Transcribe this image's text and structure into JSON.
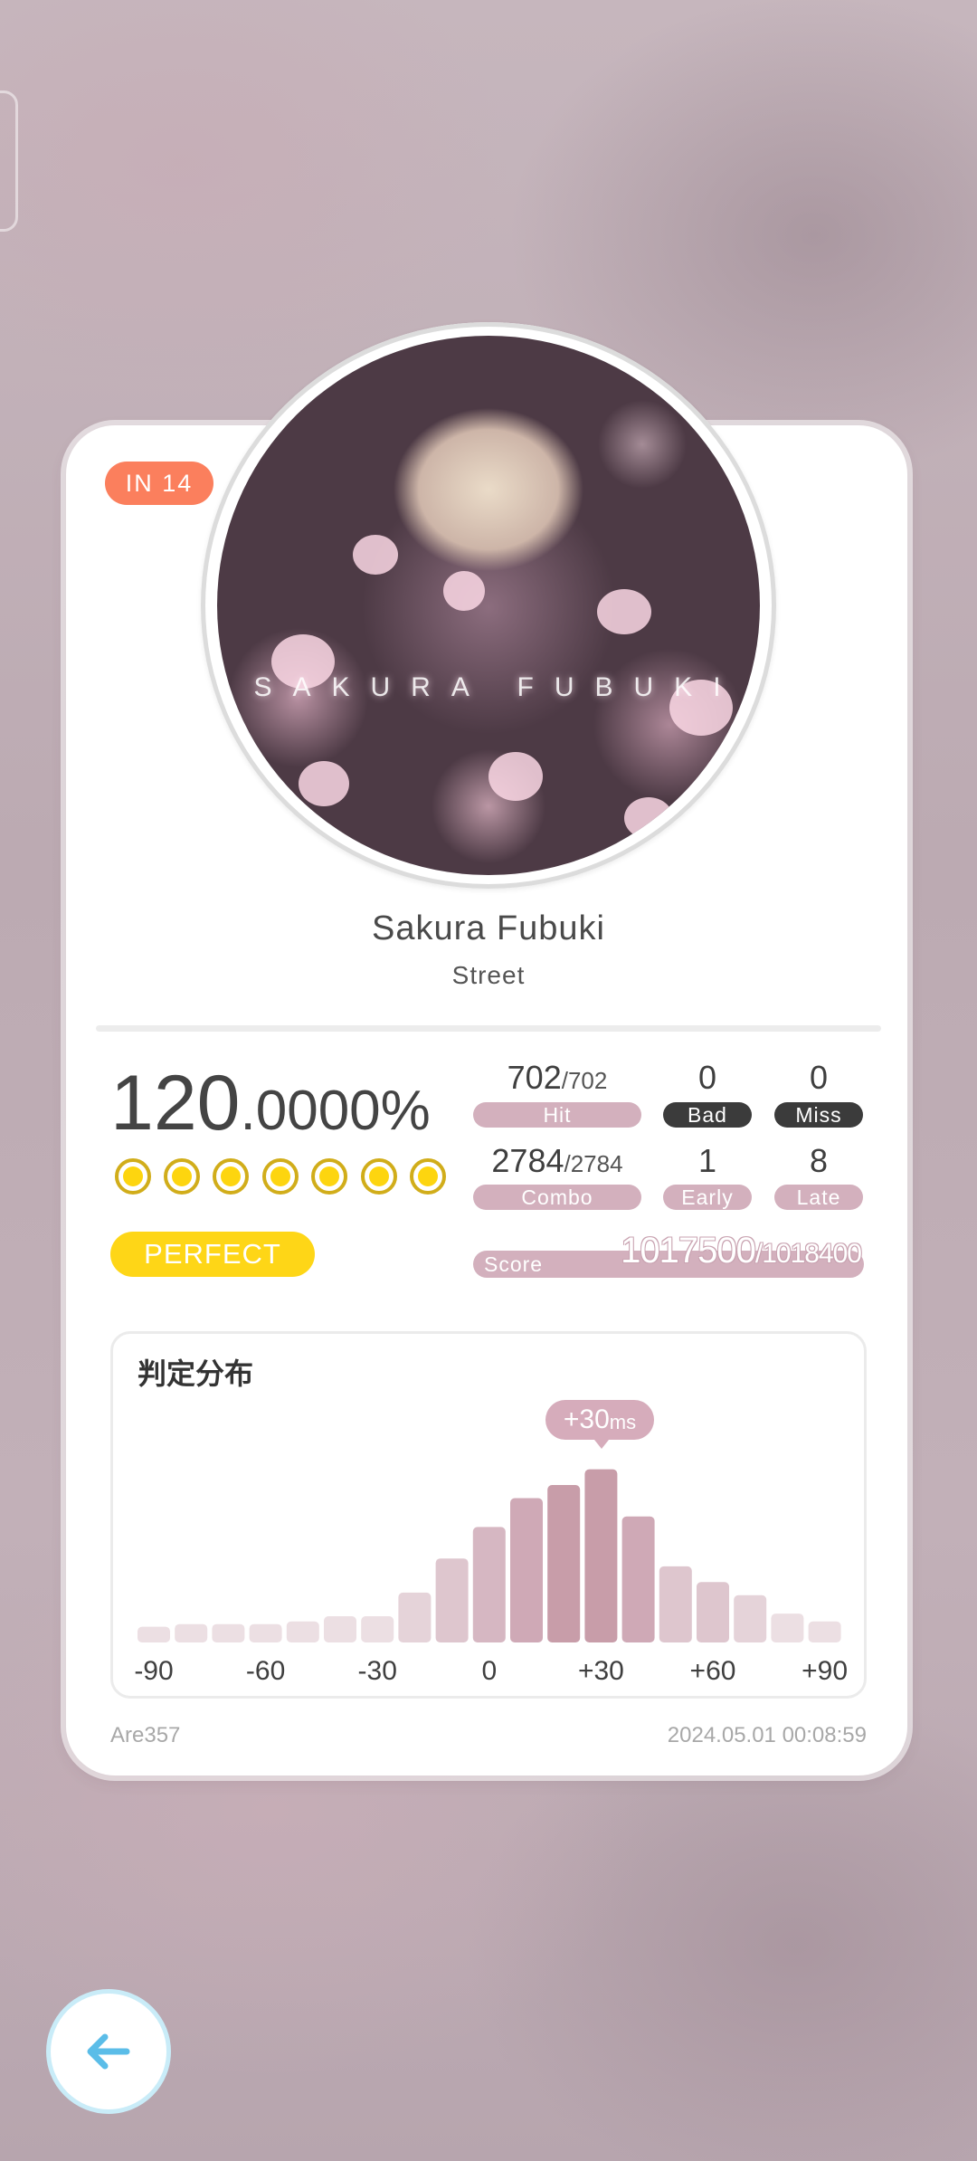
{
  "level_badge": "IN 14",
  "cover": {
    "title_overlay": "SAKURA FUBUKI"
  },
  "song": {
    "title": "Sakura Fubuki",
    "difficulty": "Street"
  },
  "accuracy": {
    "integer": "120",
    "decimal": ".0000%"
  },
  "grade": "PERFECT",
  "stats": {
    "hit": {
      "value": "702",
      "total": "/702",
      "label": "Hit"
    },
    "bad": {
      "value": "0",
      "label": "Bad"
    },
    "miss": {
      "value": "0",
      "label": "Miss"
    },
    "combo": {
      "value": "2784",
      "total": "/2784",
      "label": "Combo"
    },
    "early": {
      "value": "1",
      "label": "Early"
    },
    "late": {
      "value": "8",
      "label": "Late"
    }
  },
  "score": {
    "label": "Score",
    "value": "1017500",
    "max": "/1018400"
  },
  "distribution": {
    "title": "判定分布",
    "peak_value": "+30",
    "peak_unit": "ms"
  },
  "chart_data": {
    "type": "bar",
    "title": "判定分布",
    "x_ticks": [
      "-90",
      "-60",
      "-30",
      "0",
      "+30",
      "+60",
      "+90"
    ],
    "categories": [
      -90,
      -80,
      -70,
      -60,
      -50,
      -40,
      -30,
      -20,
      -10,
      0,
      10,
      20,
      30,
      40,
      50,
      60,
      70,
      80,
      90
    ],
    "values": [
      6,
      7,
      7,
      7,
      8,
      10,
      10,
      19,
      32,
      44,
      55,
      60,
      66,
      48,
      29,
      23,
      18,
      11,
      8
    ],
    "ylim": [
      0,
      70
    ],
    "colors": [
      "#ecdfe3",
      "#e5d3d9",
      "#dec6ce",
      "#d6b7c2",
      "#cfa9b6",
      "#c89da9"
    ],
    "grid": false
  },
  "footer": {
    "player": "Are357",
    "datetime": "2024.05.01 00:08:59"
  },
  "back_icon": "arrow-left-icon",
  "accent_colors": {
    "badge": "#fb7f5d",
    "grade": "#fed617",
    "pill": "#d3b0bd",
    "back": "#5bbde8"
  }
}
